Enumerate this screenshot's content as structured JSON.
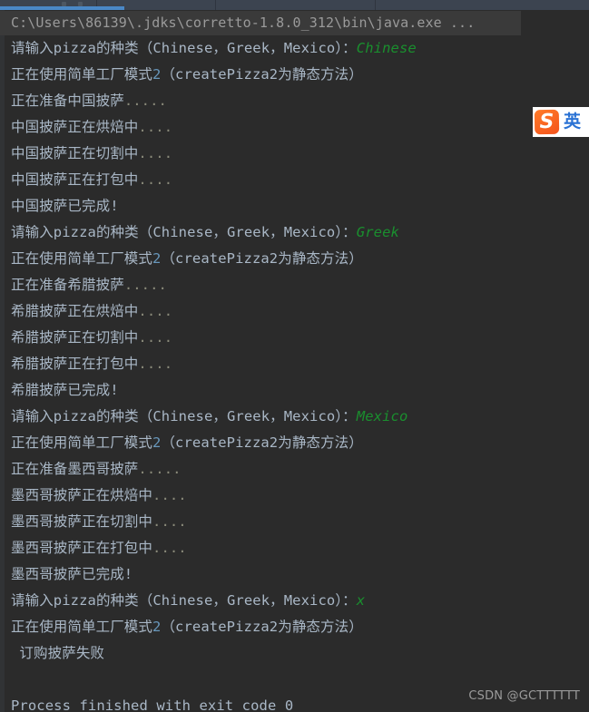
{
  "window": {
    "background_color": "#2b2b2b",
    "toolbar_color": "#3c4450",
    "accent_color": "#4a88c7"
  },
  "console": {
    "command_line": "C:\\Users\\86139\\.jdks\\corretto-1.8.0_312\\bin\\java.exe ...",
    "text_color": "#a9b7c6",
    "input_color": "#1a8f2e",
    "number_color": "#6897bb",
    "lines": [
      {
        "type": "prompt",
        "prompt": "请输入pizza的种类（Chinese，Greek，Mexico）：",
        "input": "Chinese"
      },
      {
        "type": "info",
        "pre": "正在使用简单工厂模式",
        "num": "2",
        "post": "（createPizza2为静态方法）"
      },
      {
        "type": "dots",
        "text": "正在准备中国披萨",
        "dots": "....."
      },
      {
        "type": "dots",
        "text": "中国披萨正在烘焙中",
        "dots": "...."
      },
      {
        "type": "dots",
        "text": "中国披萨正在切割中",
        "dots": "...."
      },
      {
        "type": "dots",
        "text": "中国披萨正在打包中",
        "dots": "...."
      },
      {
        "type": "plain",
        "text": "中国披萨已完成!"
      },
      {
        "type": "prompt",
        "prompt": "请输入pizza的种类（Chinese，Greek，Mexico）：",
        "input": "Greek"
      },
      {
        "type": "info",
        "pre": "正在使用简单工厂模式",
        "num": "2",
        "post": "（createPizza2为静态方法）"
      },
      {
        "type": "dots",
        "text": "正在准备希腊披萨",
        "dots": "....."
      },
      {
        "type": "dots",
        "text": "希腊披萨正在烘焙中",
        "dots": "...."
      },
      {
        "type": "dots",
        "text": "希腊披萨正在切割中",
        "dots": "...."
      },
      {
        "type": "dots",
        "text": "希腊披萨正在打包中",
        "dots": "...."
      },
      {
        "type": "plain",
        "text": "希腊披萨已完成!"
      },
      {
        "type": "prompt",
        "prompt": "请输入pizza的种类（Chinese，Greek，Mexico）：",
        "input": "Mexico"
      },
      {
        "type": "info",
        "pre": "正在使用简单工厂模式",
        "num": "2",
        "post": "（createPizza2为静态方法）"
      },
      {
        "type": "dots",
        "text": "正在准备墨西哥披萨",
        "dots": "....."
      },
      {
        "type": "dots",
        "text": "墨西哥披萨正在烘焙中",
        "dots": "...."
      },
      {
        "type": "dots",
        "text": "墨西哥披萨正在切割中",
        "dots": "...."
      },
      {
        "type": "dots",
        "text": "墨西哥披萨正在打包中",
        "dots": "...."
      },
      {
        "type": "plain",
        "text": "墨西哥披萨已完成!"
      },
      {
        "type": "prompt",
        "prompt": "请输入pizza的种类（Chinese，Greek，Mexico）：",
        "input": "x"
      },
      {
        "type": "info",
        "pre": "正在使用简单工厂模式",
        "num": "2",
        "post": "（createPizza2为静态方法）"
      },
      {
        "type": "plain",
        "text": " 订购披萨失败"
      },
      {
        "type": "blank",
        "text": ""
      },
      {
        "type": "plain",
        "text": "Process finished with exit code 0"
      }
    ]
  },
  "ime": {
    "logo_letter": "S",
    "mode_label": "英",
    "logo_color": "#f4531c",
    "mode_color": "#2a72d4"
  },
  "watermark": {
    "text": "CSDN @GCTTTTTT"
  }
}
